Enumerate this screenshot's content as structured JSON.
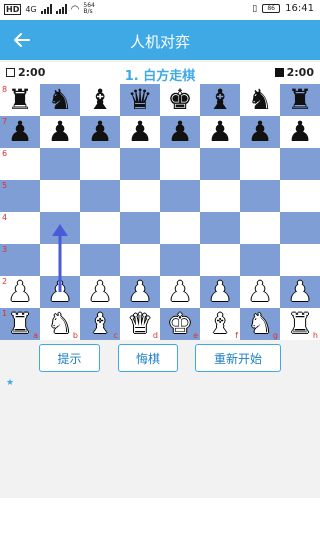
{
  "statusbar": {
    "carrier": "HD",
    "network": "4G",
    "speed_value": "564",
    "speed_unit": "B/s",
    "battery": "86",
    "time": "16:41"
  },
  "appbar": {
    "title": "人机对弈",
    "back_icon": "arrow-left"
  },
  "infobar": {
    "white_timer": "2:00",
    "black_timer": "2:00",
    "turn_text": "1. 白方走棋"
  },
  "board": {
    "ranks": [
      "8",
      "7",
      "6",
      "5",
      "4",
      "3",
      "2",
      "1"
    ],
    "files": [
      "a",
      "b",
      "c",
      "d",
      "e",
      "f",
      "g",
      "h"
    ],
    "rows": [
      [
        "bR",
        "bN",
        "bB",
        "bQ",
        "bK",
        "bB",
        "bN",
        "bR"
      ],
      [
        "bP",
        "bP",
        "bP",
        "bP",
        "bP",
        "bP",
        "bP",
        "bP"
      ],
      [
        "",
        "",
        "",
        "",
        "",
        "",
        "",
        ""
      ],
      [
        "",
        "",
        "",
        "",
        "",
        "",
        "",
        ""
      ],
      [
        "",
        "",
        "",
        "",
        "",
        "",
        "",
        ""
      ],
      [
        "",
        "",
        "",
        "",
        "",
        "",
        "",
        ""
      ],
      [
        "wP",
        "wP",
        "wP",
        "wP",
        "wP",
        "wP",
        "wP",
        "wP"
      ],
      [
        "wR",
        "wN",
        "wB",
        "wQ",
        "wK",
        "wB",
        "wN",
        "wR"
      ]
    ],
    "hint_move": {
      "from": "b2",
      "to": "b4"
    },
    "colors": {
      "light": "#ffffff",
      "dark": "#7f9ed6",
      "coord": "#e03030",
      "arrow": "#4a5bd8"
    }
  },
  "controls": {
    "hint": "提示",
    "undo": "悔棋",
    "restart": "重新开始"
  },
  "accent": "#3fa9e6",
  "star": "★"
}
